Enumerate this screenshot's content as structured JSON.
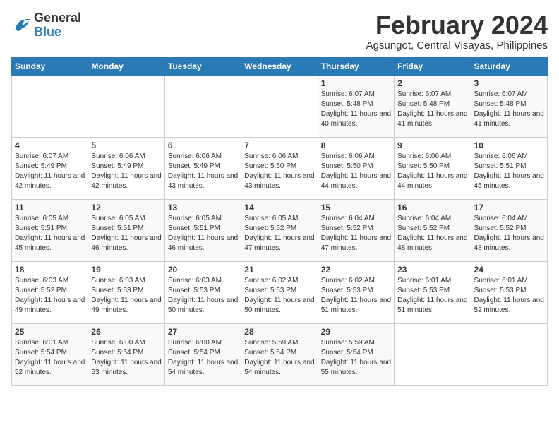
{
  "logo": {
    "text_general": "General",
    "text_blue": "Blue"
  },
  "title": {
    "month_year": "February 2024",
    "location": "Agsungot, Central Visayas, Philippines"
  },
  "days_of_week": [
    "Sunday",
    "Monday",
    "Tuesday",
    "Wednesday",
    "Thursday",
    "Friday",
    "Saturday"
  ],
  "weeks": [
    [
      {
        "day": "",
        "info": ""
      },
      {
        "day": "",
        "info": ""
      },
      {
        "day": "",
        "info": ""
      },
      {
        "day": "",
        "info": ""
      },
      {
        "day": "1",
        "info": "Sunrise: 6:07 AM\nSunset: 5:48 PM\nDaylight: 11 hours and 40 minutes."
      },
      {
        "day": "2",
        "info": "Sunrise: 6:07 AM\nSunset: 5:48 PM\nDaylight: 11 hours and 41 minutes."
      },
      {
        "day": "3",
        "info": "Sunrise: 6:07 AM\nSunset: 5:48 PM\nDaylight: 11 hours and 41 minutes."
      }
    ],
    [
      {
        "day": "4",
        "info": "Sunrise: 6:07 AM\nSunset: 5:49 PM\nDaylight: 11 hours and 42 minutes."
      },
      {
        "day": "5",
        "info": "Sunrise: 6:06 AM\nSunset: 5:49 PM\nDaylight: 11 hours and 42 minutes."
      },
      {
        "day": "6",
        "info": "Sunrise: 6:06 AM\nSunset: 5:49 PM\nDaylight: 11 hours and 43 minutes."
      },
      {
        "day": "7",
        "info": "Sunrise: 6:06 AM\nSunset: 5:50 PM\nDaylight: 11 hours and 43 minutes."
      },
      {
        "day": "8",
        "info": "Sunrise: 6:06 AM\nSunset: 5:50 PM\nDaylight: 11 hours and 44 minutes."
      },
      {
        "day": "9",
        "info": "Sunrise: 6:06 AM\nSunset: 5:50 PM\nDaylight: 11 hours and 44 minutes."
      },
      {
        "day": "10",
        "info": "Sunrise: 6:06 AM\nSunset: 5:51 PM\nDaylight: 11 hours and 45 minutes."
      }
    ],
    [
      {
        "day": "11",
        "info": "Sunrise: 6:05 AM\nSunset: 5:51 PM\nDaylight: 11 hours and 45 minutes."
      },
      {
        "day": "12",
        "info": "Sunrise: 6:05 AM\nSunset: 5:51 PM\nDaylight: 11 hours and 46 minutes."
      },
      {
        "day": "13",
        "info": "Sunrise: 6:05 AM\nSunset: 5:51 PM\nDaylight: 11 hours and 46 minutes."
      },
      {
        "day": "14",
        "info": "Sunrise: 6:05 AM\nSunset: 5:52 PM\nDaylight: 11 hours and 47 minutes."
      },
      {
        "day": "15",
        "info": "Sunrise: 6:04 AM\nSunset: 5:52 PM\nDaylight: 11 hours and 47 minutes."
      },
      {
        "day": "16",
        "info": "Sunrise: 6:04 AM\nSunset: 5:52 PM\nDaylight: 11 hours and 48 minutes."
      },
      {
        "day": "17",
        "info": "Sunrise: 6:04 AM\nSunset: 5:52 PM\nDaylight: 11 hours and 48 minutes."
      }
    ],
    [
      {
        "day": "18",
        "info": "Sunrise: 6:03 AM\nSunset: 5:52 PM\nDaylight: 11 hours and 49 minutes."
      },
      {
        "day": "19",
        "info": "Sunrise: 6:03 AM\nSunset: 5:53 PM\nDaylight: 11 hours and 49 minutes."
      },
      {
        "day": "20",
        "info": "Sunrise: 6:03 AM\nSunset: 5:53 PM\nDaylight: 11 hours and 50 minutes."
      },
      {
        "day": "21",
        "info": "Sunrise: 6:02 AM\nSunset: 5:53 PM\nDaylight: 11 hours and 50 minutes."
      },
      {
        "day": "22",
        "info": "Sunrise: 6:02 AM\nSunset: 5:53 PM\nDaylight: 11 hours and 51 minutes."
      },
      {
        "day": "23",
        "info": "Sunrise: 6:01 AM\nSunset: 5:53 PM\nDaylight: 11 hours and 51 minutes."
      },
      {
        "day": "24",
        "info": "Sunrise: 6:01 AM\nSunset: 5:53 PM\nDaylight: 11 hours and 52 minutes."
      }
    ],
    [
      {
        "day": "25",
        "info": "Sunrise: 6:01 AM\nSunset: 5:54 PM\nDaylight: 11 hours and 52 minutes."
      },
      {
        "day": "26",
        "info": "Sunrise: 6:00 AM\nSunset: 5:54 PM\nDaylight: 11 hours and 53 minutes."
      },
      {
        "day": "27",
        "info": "Sunrise: 6:00 AM\nSunset: 5:54 PM\nDaylight: 11 hours and 54 minutes."
      },
      {
        "day": "28",
        "info": "Sunrise: 5:59 AM\nSunset: 5:54 PM\nDaylight: 11 hours and 54 minutes."
      },
      {
        "day": "29",
        "info": "Sunrise: 5:59 AM\nSunset: 5:54 PM\nDaylight: 11 hours and 55 minutes."
      },
      {
        "day": "",
        "info": ""
      },
      {
        "day": "",
        "info": ""
      }
    ]
  ]
}
